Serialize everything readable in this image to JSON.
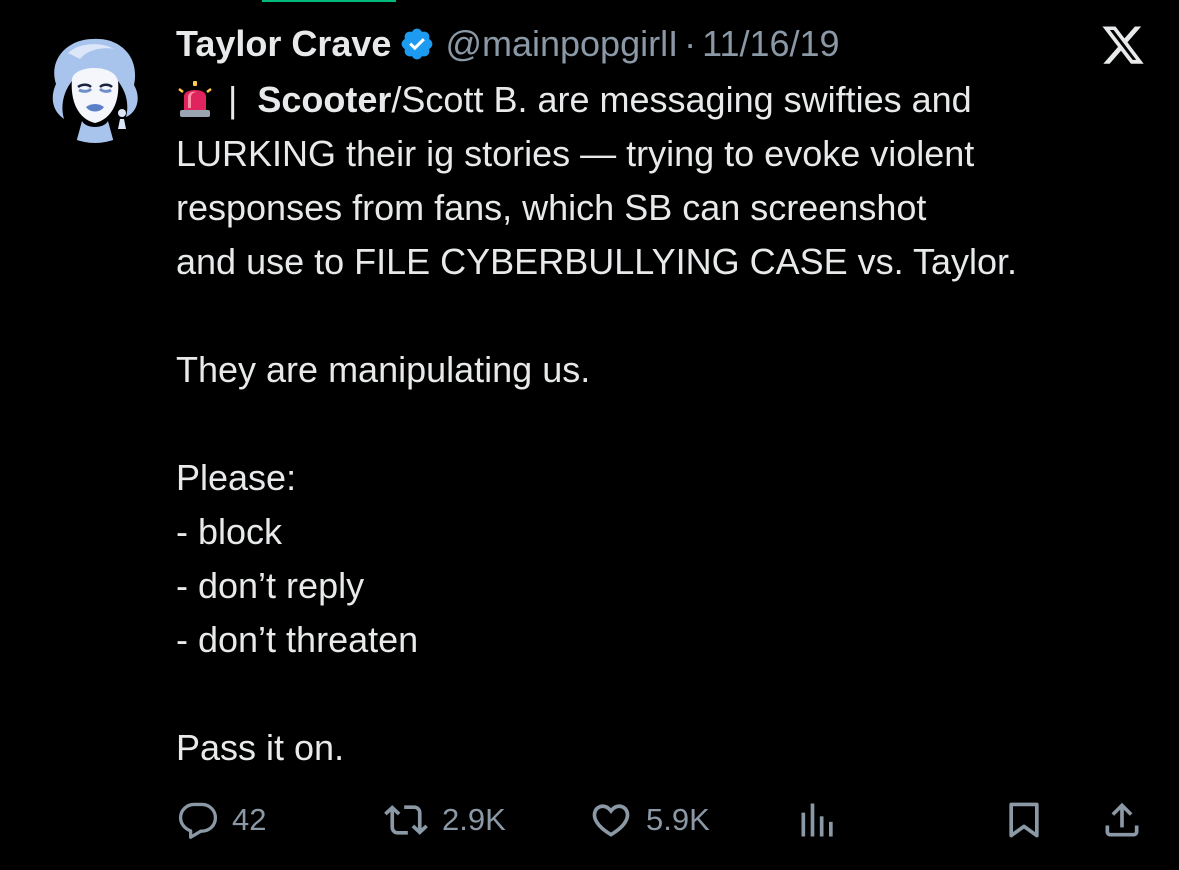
{
  "tweet": {
    "author_name": "Taylor Crave",
    "handle": "@mainpopgirlI",
    "separator": "·",
    "date": "11/16/19",
    "line1_sep": "|",
    "line1_bold": "Scooter",
    "line1_rest": "/Scott B. are messaging swifties and",
    "line2": "LURKING their ig stories — trying to evoke violent",
    "line3": "responses from fans, which SB can screenshot",
    "line4": "and use to FILE CYBERBULLYING CASE vs. Taylor.",
    "para2": "They are manipulating us.",
    "para3_title": "Please:",
    "list": [
      "- block",
      "- don’t reply",
      "- don’t threaten"
    ],
    "para4": "Pass it on."
  },
  "actions": {
    "replies": "42",
    "reposts": "2.9K",
    "likes": "5.9K"
  },
  "icons": {
    "verified": "verified-badge-icon",
    "siren": "siren-emoji-icon",
    "x_logo": "x-logo-icon",
    "reply": "reply-icon",
    "repost": "repost-icon",
    "like": "heart-icon",
    "views": "views-chart-icon",
    "bookmark": "bookmark-icon",
    "share": "share-icon"
  },
  "colors": {
    "background": "#000000",
    "text": "#e7e9ea",
    "muted": "#8b98a5",
    "verified": "#1d9bf0",
    "accent": "#00ba7c"
  }
}
